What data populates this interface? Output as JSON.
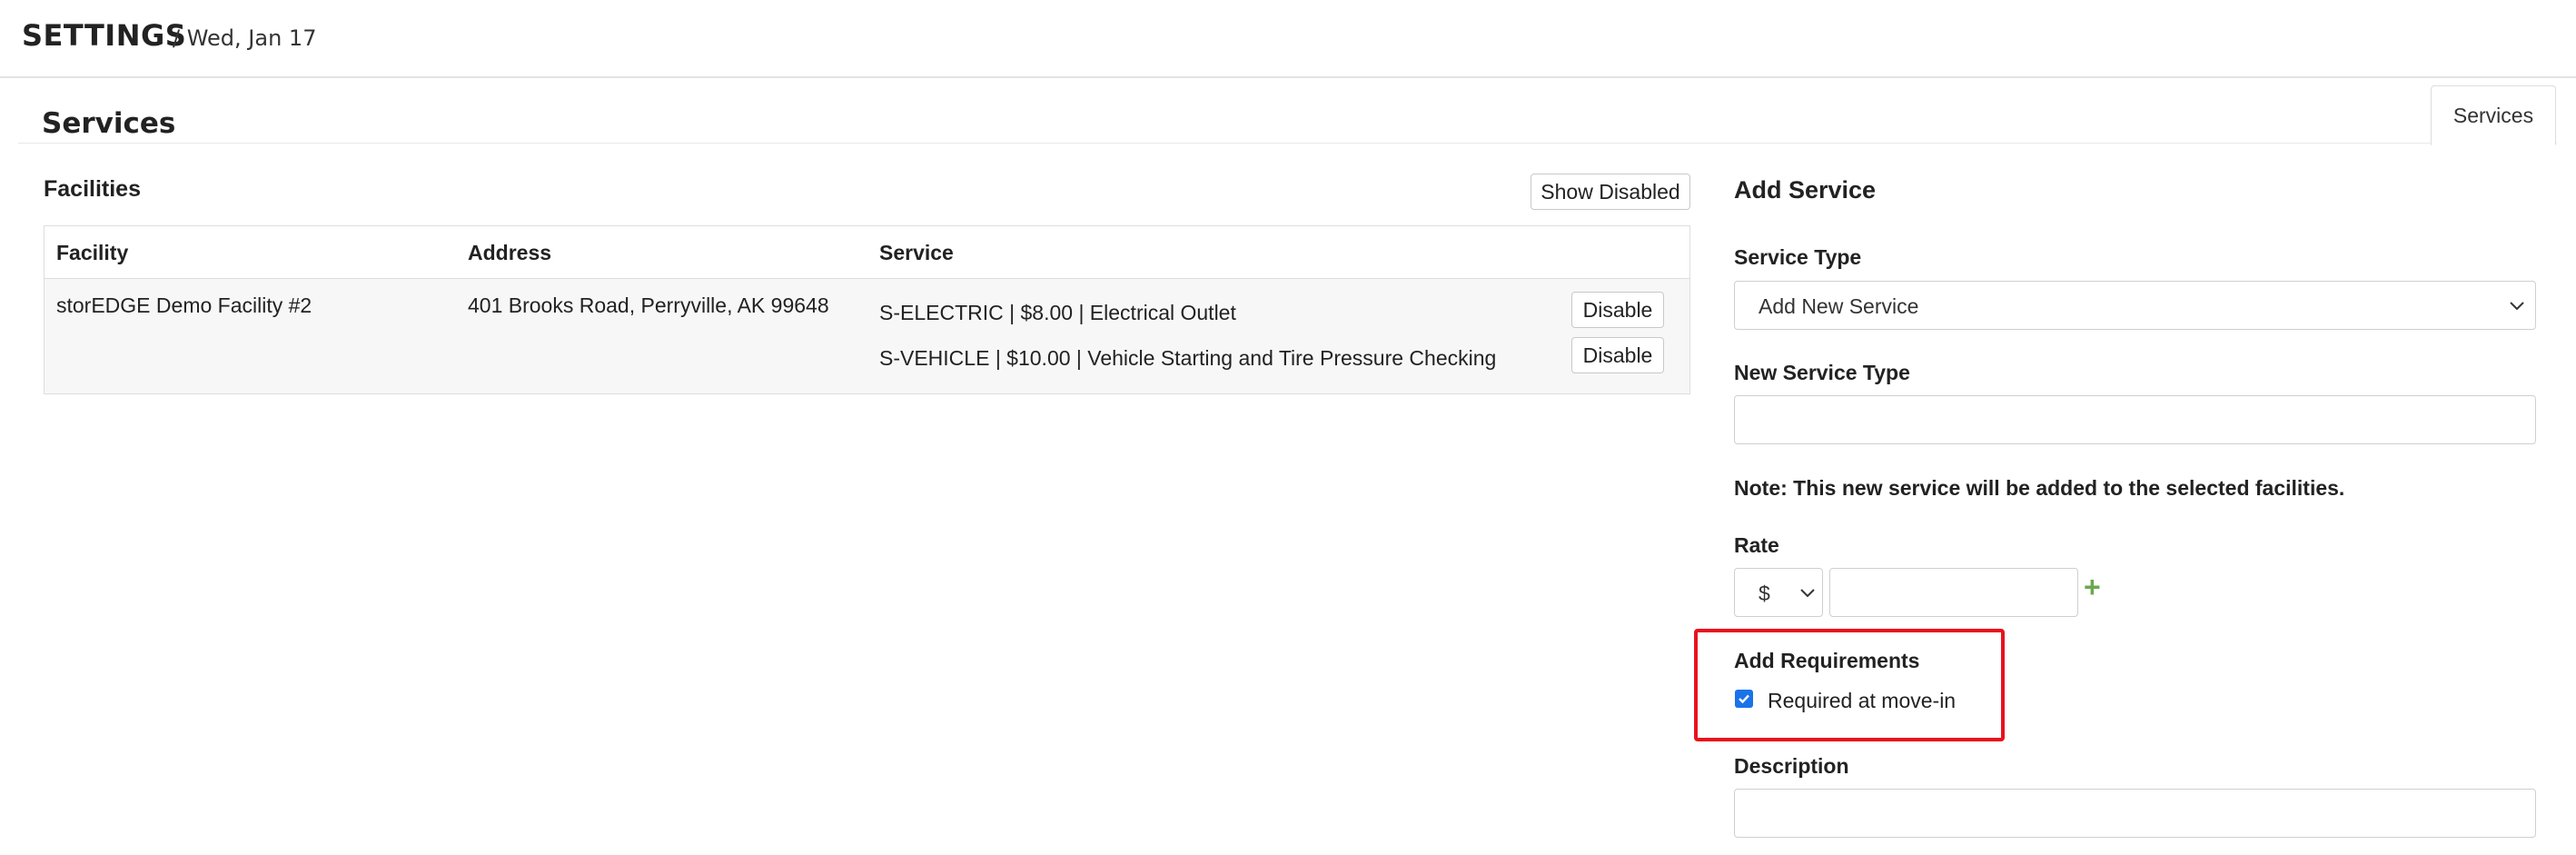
{
  "header": {
    "title": "SETTINGS",
    "date": "/ Wed, Jan 17"
  },
  "panel": {
    "title": "Services",
    "tab_label": "Services"
  },
  "facilities": {
    "heading": "Facilities",
    "show_disabled_label": "Show Disabled",
    "columns": [
      "Facility",
      "Address",
      "Service"
    ],
    "rows": [
      {
        "facility": "storEDGE Demo Facility #2",
        "address": "401 Brooks Road, Perryville, AK 99648",
        "services": [
          {
            "text": "S-ELECTRIC | $8.00 | Electrical Outlet",
            "action": "Disable"
          },
          {
            "text": "S-VEHICLE | $10.00 | Vehicle Starting and Tire Pressure Checking",
            "action": "Disable"
          }
        ]
      }
    ]
  },
  "add_service": {
    "heading": "Add Service",
    "service_type_label": "Service Type",
    "service_type_value": "Add New Service",
    "new_service_type_label": "New Service Type",
    "new_service_type_value": "",
    "note": "Note: This new service will be added to the selected facilities.",
    "rate_label": "Rate",
    "currency_value": "$",
    "rate_value": "",
    "add_rate_symbol": "+",
    "requirements_label": "Add Requirements",
    "required_move_in_label": "Required at move-in",
    "required_move_in_checked": true,
    "description_label": "Description",
    "description_value": ""
  },
  "colors": {
    "accent_check": "#1a73e8",
    "highlight": "#e8121e",
    "plus": "#6aa84f"
  }
}
